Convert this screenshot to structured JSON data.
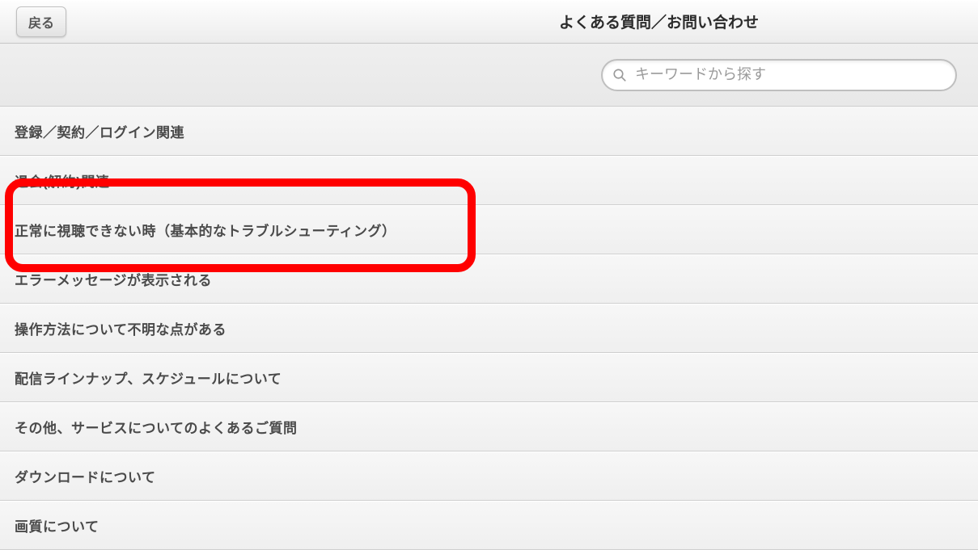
{
  "topbar": {
    "back_label": "戻る",
    "title": "よくある質問／お問い合わせ"
  },
  "search": {
    "placeholder": "キーワードから探す",
    "value": ""
  },
  "categories": [
    {
      "label": "登録／契約／ログイン関連"
    },
    {
      "label": "退会(解約)関連"
    },
    {
      "label": "正常に視聴できない時（基本的なトラブルシューティング）"
    },
    {
      "label": "エラーメッセージが表示される"
    },
    {
      "label": "操作方法について不明な点がある"
    },
    {
      "label": "配信ラインナップ、スケジュールについて"
    },
    {
      "label": "その他、サービスについてのよくあるご質問"
    },
    {
      "label": "ダウンロードについて"
    },
    {
      "label": "画質について"
    }
  ],
  "highlight_index": 2
}
